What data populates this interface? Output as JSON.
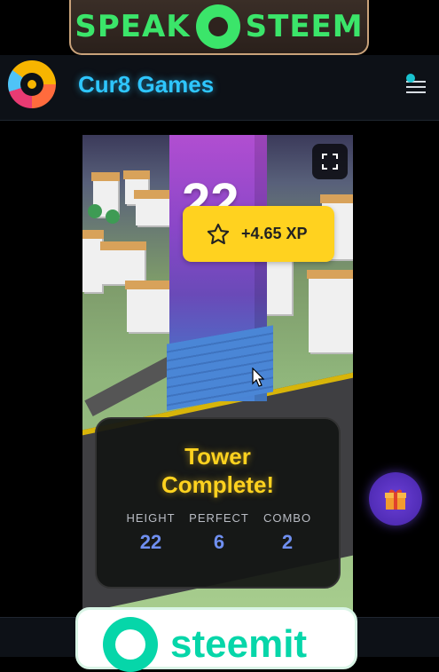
{
  "banner": {
    "left_text": "SPEAK",
    "right_text": "STEEM"
  },
  "header": {
    "title": "Cur8 Games"
  },
  "game": {
    "score": "22",
    "xp_text": "+4.65 XP",
    "result_title": "Tower Complete!",
    "stats": [
      {
        "label": "HEIGHT",
        "value": "22"
      },
      {
        "label": "PERFECT",
        "value": "6"
      },
      {
        "label": "COMBO",
        "value": "2"
      }
    ]
  },
  "bottom_banner": {
    "text": "steemit"
  },
  "colors": {
    "accent": "#2ec6ff",
    "xp_badge": "#ffd21f",
    "stat_value": "#6f8ff0",
    "steem_green": "#3be56a",
    "steemit_green": "#06d6a9"
  }
}
